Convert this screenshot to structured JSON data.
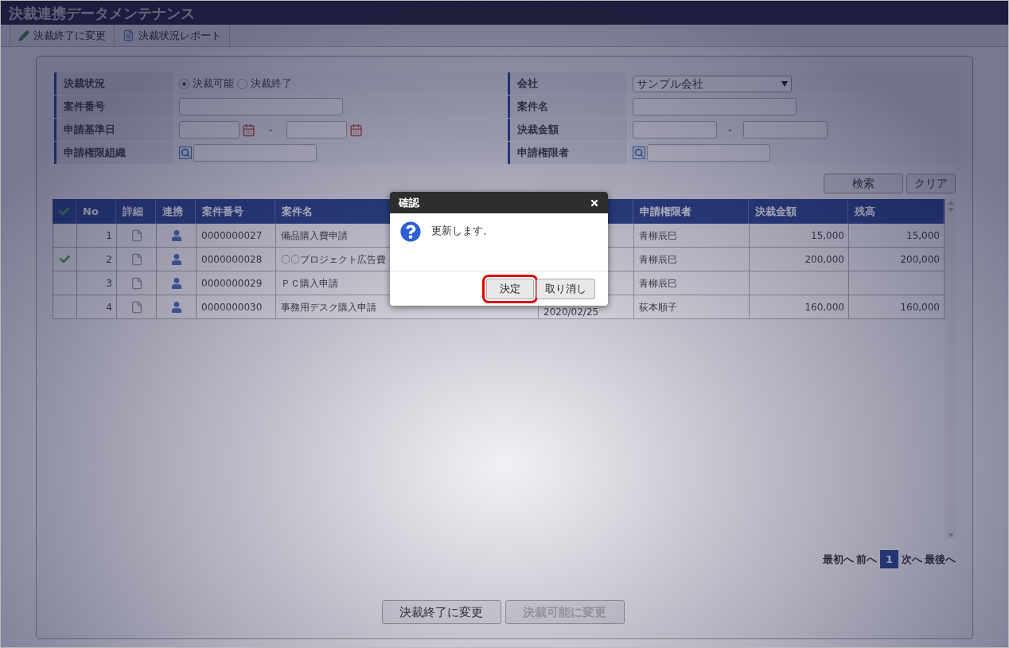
{
  "window": {
    "title": "決裁連携データメンテナンス"
  },
  "toolbar": [
    {
      "label": "決裁終了に変更"
    },
    {
      "label": "決裁状況レポート"
    }
  ],
  "search_form": {
    "fields": [
      {
        "label": "決裁状況",
        "kind": "radio",
        "options": [
          {
            "label": "決裁可能",
            "selected": true
          },
          {
            "label": "決裁終了",
            "selected": false
          }
        ]
      },
      {
        "label": "会社",
        "kind": "select",
        "value": "サンプル会社"
      },
      {
        "label": "案件番号",
        "kind": "text"
      },
      {
        "label": "案件名",
        "kind": "text"
      },
      {
        "label": "申請基準日",
        "kind": "date_range",
        "separator": "-"
      },
      {
        "label": "決裁金額",
        "kind": "number_range",
        "separator": "-"
      },
      {
        "label": "申請権限組織",
        "kind": "lookup"
      },
      {
        "label": "申請権限者",
        "kind": "lookup"
      }
    ],
    "buttons": [
      "検索",
      "クリア"
    ]
  },
  "table": {
    "columns": [
      {
        "kind": "check"
      },
      {
        "kind": "text",
        "label": "No"
      },
      {
        "kind": "text",
        "label": "詳細"
      },
      {
        "kind": "text",
        "label": "連携"
      },
      {
        "kind": "text",
        "label": "案件番号"
      },
      {
        "kind": "text",
        "label": "案件名"
      },
      {
        "kind": "covered"
      },
      {
        "kind": "text",
        "label": "申請権限者"
      },
      {
        "kind": "text",
        "label": "決裁金額"
      },
      {
        "kind": "text",
        "label": "残高"
      }
    ],
    "rows": [
      {
        "checked": false,
        "no": "1",
        "case_number": "0000000027",
        "case_name": "備品購入費申請",
        "applicant": "青柳辰巳",
        "amount": "15,000",
        "balance": "15,000"
      },
      {
        "checked": true,
        "no": "2",
        "case_number": "0000000028",
        "case_name": "〇〇プロジェクト広告費",
        "applicant": "青柳辰巳",
        "amount": "200,000",
        "balance": "200,000"
      },
      {
        "checked": false,
        "no": "3",
        "case_number": "0000000029",
        "case_name": "ＰＣ購入申請",
        "applicant": "青柳辰巳"
      },
      {
        "checked": false,
        "no": "4",
        "case_number": "0000000030",
        "case_name": "事務用デスク購入申請",
        "date": "2020/02/25",
        "applicant": "荻本順子",
        "amount": "160,000",
        "balance": "160,000"
      }
    ]
  },
  "pager": {
    "first": "最初へ",
    "prev": "前へ",
    "pages": [
      {
        "label": "1",
        "selected": true
      }
    ],
    "next": "次へ",
    "last": "最後へ"
  },
  "actions": [
    {
      "label": "決裁終了に変更",
      "disabled": false
    },
    {
      "label": "決裁可能に変更",
      "disabled": true
    }
  ],
  "dialog": {
    "title": "確認",
    "message": "更新します。",
    "buttons": [
      {
        "label": "決定",
        "highlighted": true
      },
      {
        "label": "取り消し",
        "highlighted": false
      }
    ]
  }
}
